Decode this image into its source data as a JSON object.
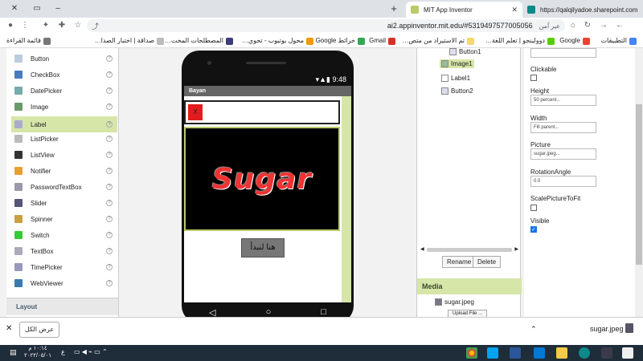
{
  "browser": {
    "tabs": [
      {
        "title": "MIT App Inventor",
        "active": true
      },
      {
        "title": "https://qalqilyadoe.sharepoint.com",
        "active": false
      }
    ],
    "new_tab": "+",
    "url": "ai2.appinventor.mit.edu/#5319497577005056",
    "profile_label": "عير آمن",
    "window_min": "–",
    "window_max": "▭",
    "window_close": "✕"
  },
  "bookmarks": [
    "التطبيقات",
    "Google",
    "دوولينجو | تعلم اللغة…",
    "تم الاستيراد من متص…",
    "Gmail",
    "خرائط Google",
    "محول يوتيوب - تحوي…",
    "المصطلحات المخت…",
    "صداقة | اختبار الصدا…",
    "قائمة القراءة"
  ],
  "palette": {
    "items": [
      {
        "label": "Button",
        "color": "#bcd"
      },
      {
        "label": "CheckBox",
        "color": "#4a7abf"
      },
      {
        "label": "DatePicker",
        "color": "#7aa"
      },
      {
        "label": "Image",
        "color": "#6a9a6a"
      },
      {
        "label": "Label",
        "color": "#aac"
      },
      {
        "label": "ListPicker",
        "color": "#bbb"
      },
      {
        "label": "ListView",
        "color": "#333"
      },
      {
        "label": "Notifier",
        "color": "#e8a030"
      },
      {
        "label": "PasswordTextBox",
        "color": "#99a"
      },
      {
        "label": "Slider",
        "color": "#557"
      },
      {
        "label": "Spinner",
        "color": "#caa040"
      },
      {
        "label": "Switch",
        "color": "#3c3"
      },
      {
        "label": "TextBox",
        "color": "#aab"
      },
      {
        "label": "TimePicker",
        "color": "#99b"
      },
      {
        "label": "WebViewer",
        "color": "#3a7ab0"
      }
    ],
    "selected_index": 4,
    "help_glyph": "?",
    "layout_header": "Layout"
  },
  "viewer": {
    "status_time": "9:48",
    "screen_title": "Bayan",
    "textbox_button": "X",
    "image_text": "Sugar",
    "start_button": "هنا لنبدأ",
    "nav_back": "◁",
    "nav_home": "○",
    "nav_recent": "□"
  },
  "components": {
    "tree": [
      {
        "label": "Button1",
        "indent": 1
      },
      {
        "label": "Image1",
        "indent": 1,
        "selected": true
      },
      {
        "label": "Label1",
        "indent": 1
      },
      {
        "label": "Button2",
        "indent": 1
      }
    ],
    "rename": "Rename",
    "delete": "Delete",
    "media_header": "Media",
    "media_file": "sugar.jpeg",
    "upload_file": "Upload File ..."
  },
  "properties": {
    "clickable_label": "Clickable",
    "clickable": false,
    "height_label": "Height",
    "height_value": "50 percent...",
    "width_label": "Width",
    "width_value": "Fill parent...",
    "picture_label": "Picture",
    "picture_value": "sugar.jpeg...",
    "rotation_label": "RotationAngle",
    "rotation_value": "0.0",
    "scale_label": "ScalePictureToFit",
    "scale": false,
    "visible_label": "Visible",
    "visible": true
  },
  "downloads": {
    "show_all": "عرض الكل",
    "close": "✕",
    "file": "sugar.jpeg"
  },
  "taskbar": {
    "time": "١٠:١٤ م",
    "date": "٢٠٢٢/٠٥/٠١",
    "lang": "ع"
  }
}
